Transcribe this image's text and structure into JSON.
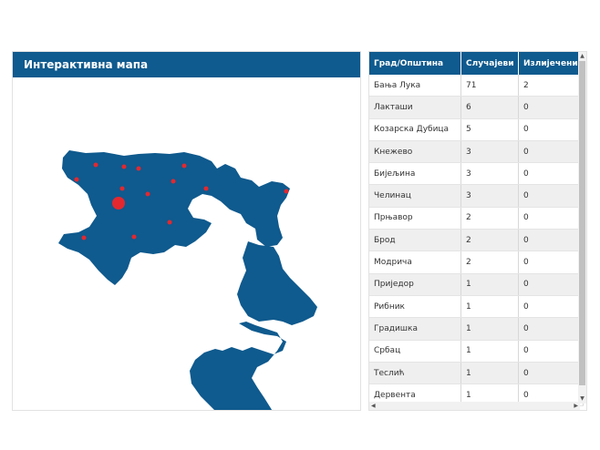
{
  "map": {
    "title": "Интерактивна мапа",
    "region_color": "#0f5a8e",
    "marker_color": "#e3282f"
  },
  "table": {
    "headers": [
      "Град/Општина",
      "Случајеви",
      "Излијечени"
    ],
    "rows": [
      [
        "Бања Лука",
        "71",
        "2"
      ],
      [
        "Лакташи",
        "6",
        "0"
      ],
      [
        "Козарска Дубица",
        "5",
        "0"
      ],
      [
        "Кнежево",
        "3",
        "0"
      ],
      [
        "Бијељина",
        "3",
        "0"
      ],
      [
        "Челинац",
        "3",
        "0"
      ],
      [
        "Прњавор",
        "2",
        "0"
      ],
      [
        "Брод",
        "2",
        "0"
      ],
      [
        "Модрича",
        "2",
        "0"
      ],
      [
        "Приједор",
        "1",
        "0"
      ],
      [
        "Рибник",
        "1",
        "0"
      ],
      [
        "Градишка",
        "1",
        "0"
      ],
      [
        "Србац",
        "1",
        "0"
      ],
      [
        "Теслић",
        "1",
        "0"
      ],
      [
        "Дервента",
        "1",
        "0"
      ]
    ]
  }
}
